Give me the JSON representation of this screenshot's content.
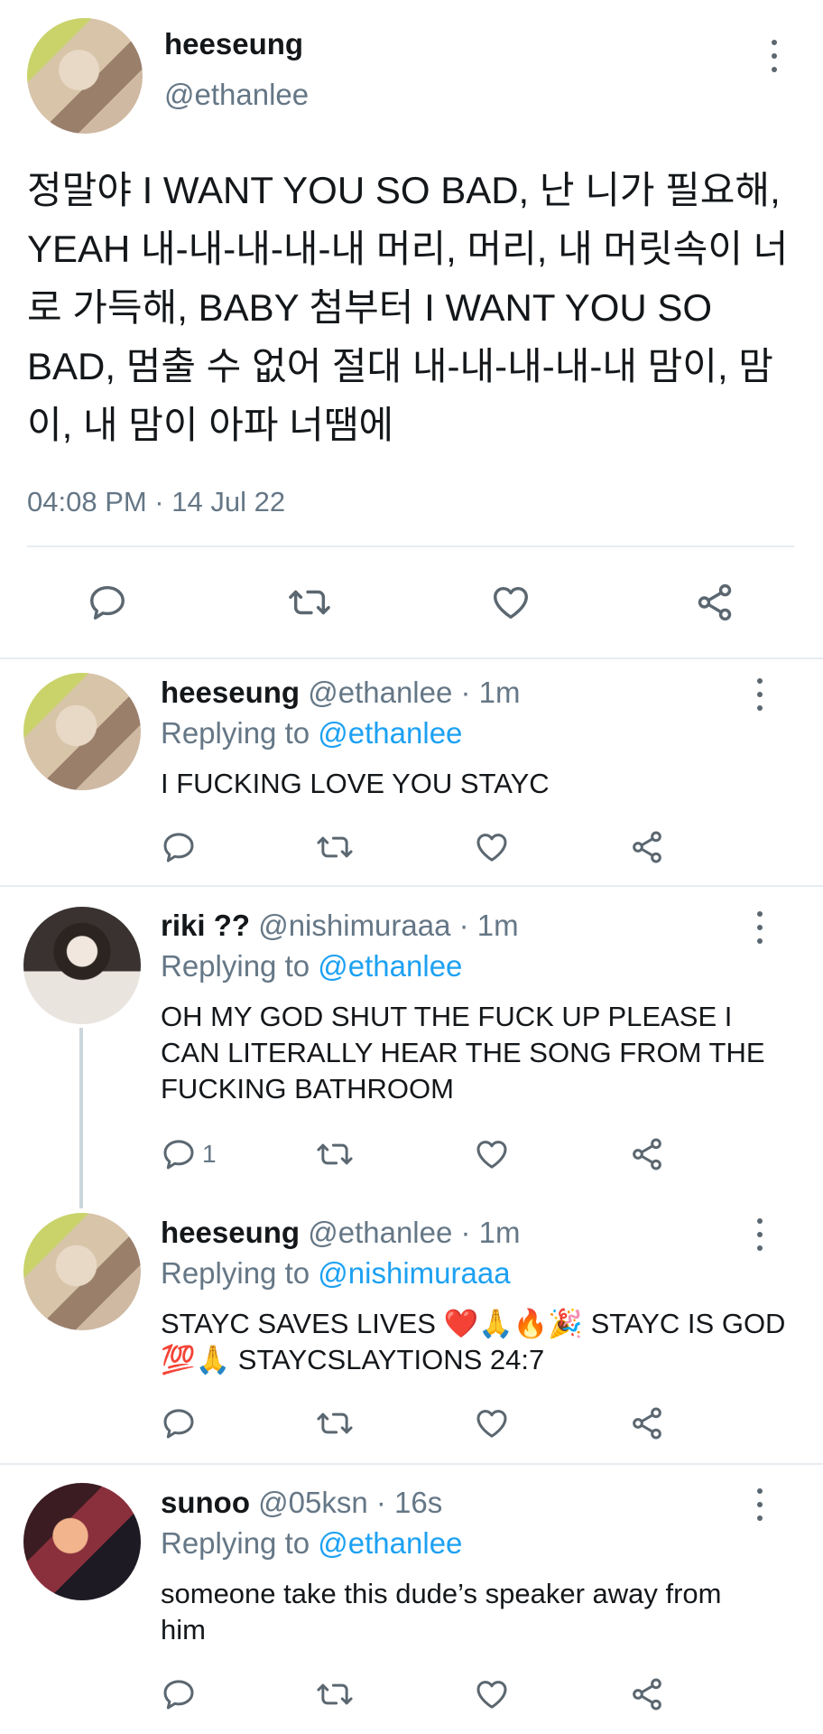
{
  "main_tweet": {
    "name": "heeseung",
    "handle": "@ethanlee",
    "text": "정말야 I WANT YOU SO BAD, 난 니가 필요해, YEAH 내-내-내-내-내 머리, 머리, 내 머릿속이 너로 가득해, BABY 첨부터 I WANT YOU SO BAD, 멈출 수 없어 절대 내-내-내-내-내 맘이, 맘이, 내 맘이 아파 너땜에",
    "timestamp": "04:08 PM · 14 Jul 22"
  },
  "replies": [
    {
      "name": "heeseung",
      "handle": "@ethanlee · 1m",
      "replying_prefix": "Replying to",
      "replying_to": "@ethanlee",
      "text": "I FUCKING LOVE YOU STAYC",
      "reply_count": ""
    },
    {
      "name": "riki ??",
      "handle": "@nishimuraaa · 1m",
      "replying_prefix": "Replying to",
      "replying_to": "@ethanlee",
      "text": "OH MY GOD SHUT THE FUCK UP PLEASE I CAN LITERALLY HEAR THE SONG FROM THE FUCKING BATHROOM",
      "reply_count": "1"
    },
    {
      "name": "heeseung",
      "handle": "@ethanlee · 1m",
      "replying_prefix": "Replying to",
      "replying_to": "@nishimuraaa",
      "text": "STAYC SAVES LIVES ❤️🙏🔥🎉 STAYC IS GOD 💯🙏 STAYCSLAYTIONS 24:7",
      "reply_count": ""
    },
    {
      "name": "sunoo",
      "handle": "@05ksn · 16s",
      "replying_prefix": "Replying to",
      "replying_to": "@ethanlee",
      "text": "someone take this dude’s speaker away from him",
      "reply_count": ""
    }
  ],
  "icons": [
    "more-vertical-icon",
    "reply-icon",
    "retweet-icon",
    "like-icon",
    "share-icon"
  ],
  "colors": {
    "link": "#1da1f2",
    "muted": "#657786",
    "icon": "#5b6770",
    "divider": "#e6ecf0"
  }
}
